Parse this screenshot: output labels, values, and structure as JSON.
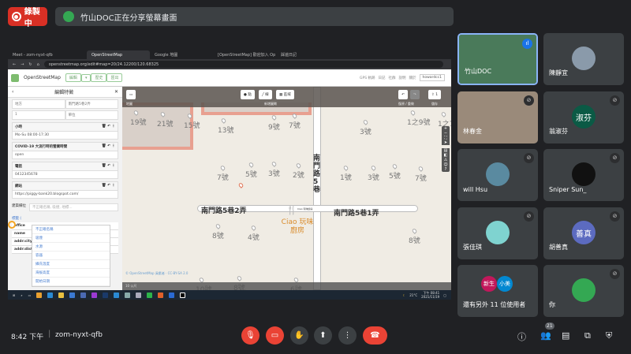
{
  "recording": {
    "label": "錄製中"
  },
  "banner": {
    "text": "竹山DOC正在分享螢幕畫面"
  },
  "browser": {
    "tabs": [
      "Meet - zom-nyxt-qfb",
      "",
      "OpenStreetMap",
      "Google 地圖",
      "[OpenStreetMap] 歡迎加入 Op",
      "踩遍日記"
    ],
    "url": "openstreetmap.org/edit#map=20/24.12200/120.68325"
  },
  "osm": {
    "brand": "OpenStreetMap",
    "buttons": [
      "編輯",
      "▾",
      "歷史",
      "匯出"
    ],
    "nav": [
      "GPS 軌跡",
      "日記",
      "社群",
      "說明",
      "關於"
    ],
    "user": "howardcc1",
    "toolbar": {
      "panel_label": "地圖",
      "point": "點",
      "line": "線",
      "area": "區域",
      "add_label": "新增圖徵",
      "undo_label": "復原 / 重做",
      "save": "1",
      "save_label": "儲存"
    },
    "attribution": "© OpenStreetMap 貢獻者 · CC-BY-SA 2.0",
    "scale": "10 公尺"
  },
  "sidebar": {
    "title": "編輯特徵",
    "addr_row1": [
      "地方",
      "南門路5巷2弄"
    ],
    "addr_row2": [
      "1",
      "單位"
    ],
    "fields": [
      {
        "label": "小時",
        "value": "Mo-Su 08:00-17:30"
      },
      {
        "label": "COVID-19 大流行時的營業時間",
        "value": "open"
      },
      {
        "label": "電話",
        "value": "0412345678"
      },
      {
        "label": "網站",
        "value": "https://piggy-bank20.blogspot.com/"
      }
    ],
    "more_label": "建築欄位",
    "more_placeholder": "不正確名稱, 吸煙, 地標...",
    "dropdown": [
      "不正確名稱",
      "吸煙",
      "水源",
      "容器",
      "攝氏溫度",
      "海拔高度",
      "開始日期"
    ],
    "tags_label": "標籤 (",
    "tag_keys": [
      "office",
      "name",
      "addr:city",
      "addr:dist"
    ]
  },
  "map": {
    "house_numbers": [
      "19號",
      "21號",
      "15號",
      "13號",
      "9號",
      "7號",
      "1之9號",
      "1之7號",
      "3號",
      "7號",
      "5號",
      "3號",
      "2號",
      "1號",
      "3號",
      "5號",
      "7號",
      "8號",
      "4號",
      "8號",
      "10號",
      "8號",
      "6號"
    ],
    "streets": [
      "南門路5巷2弄",
      "南門路5巷1弄",
      "南門路5巷"
    ],
    "poi": "Ciao 玩味廚房",
    "poi_small": "Ciao 玩味廚房"
  },
  "taskbar": {
    "weather": "21°C",
    "time": "下午 08:41",
    "date": "2021/11/19"
  },
  "participants": [
    {
      "name": "竹山DOC",
      "speaking": true,
      "color": "#4a7a5a"
    },
    {
      "name": "陳靜宜",
      "color": "#8a9aaa"
    },
    {
      "name": "林春金",
      "muted": true,
      "color": "#9a8a7a"
    },
    {
      "name": "翁淑芬",
      "avatar": "淑芬",
      "muted": true,
      "color": "#0b5a45"
    },
    {
      "name": "will Hsu",
      "muted": true,
      "color": "#5a8aa0"
    },
    {
      "name": "Sniper Sun_",
      "muted": true,
      "color": "#111111"
    },
    {
      "name": "張佳琪",
      "muted": true,
      "color": "#7fd3d0"
    },
    {
      "name": "胡善真",
      "avatar": "善真",
      "muted": true,
      "color": "#5c6bc0"
    },
    {
      "name": "還有另外 11 位使用者",
      "avatars": [
        "新生",
        "小美"
      ]
    },
    {
      "name": "你",
      "muted": true,
      "color": "#34a853",
      "avatar": "竹山DOC"
    }
  ],
  "footer": {
    "time": "8:42 下午",
    "meeting_code": "zom-nyxt-qfb",
    "people_count": "21"
  },
  "colors": {
    "bg": "#202124",
    "red": "#ea4335",
    "tile": "#3c4043",
    "osm_green": "#7ebc6f",
    "poi": "#d98b2b"
  }
}
